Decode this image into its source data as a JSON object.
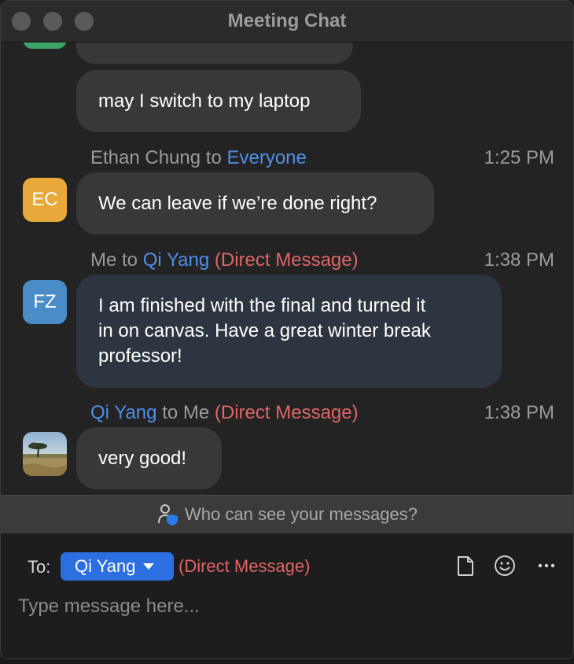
{
  "window": {
    "title": "Meeting Chat"
  },
  "messages": [
    {
      "text": "may I switch to my laptop"
    },
    {
      "sender": "Ethan Chung",
      "to_word": "to",
      "recipient": "Everyone",
      "time": "1:25 PM",
      "initials": "EC",
      "avatar_color": "#e8a93a",
      "text": "We can leave if we’re done right?"
    },
    {
      "sender": "Me",
      "to_word": "to",
      "recipient": "Qi Yang",
      "dm": "(Direct Message)",
      "time": "1:38 PM",
      "initials": "FZ",
      "avatar_color": "#4a8cc8",
      "lines": [
        "I am finished with the final and turned it",
        "in on canvas. Have a great winter break",
        "professor!"
      ]
    },
    {
      "sender": "Qi Yang",
      "to_word": "to",
      "recipient": "Me",
      "dm": "(Direct Message)",
      "time": "1:38 PM",
      "avatar_image": "savanna-landscape-photo",
      "text": "very good!"
    }
  ],
  "privacy": {
    "icon": "user-shield-icon",
    "text": "Who can see your messages?"
  },
  "compose": {
    "to_label": "To:",
    "recipient": "Qi Yang",
    "dm_label": "(Direct Message)",
    "placeholder": "Type message here...",
    "tools": [
      "file-icon",
      "emoji-icon",
      "more-icon"
    ]
  },
  "colors": {
    "accent": "#2b6fe0",
    "link": "#4f8fe8",
    "direct_message": "#e06565"
  }
}
